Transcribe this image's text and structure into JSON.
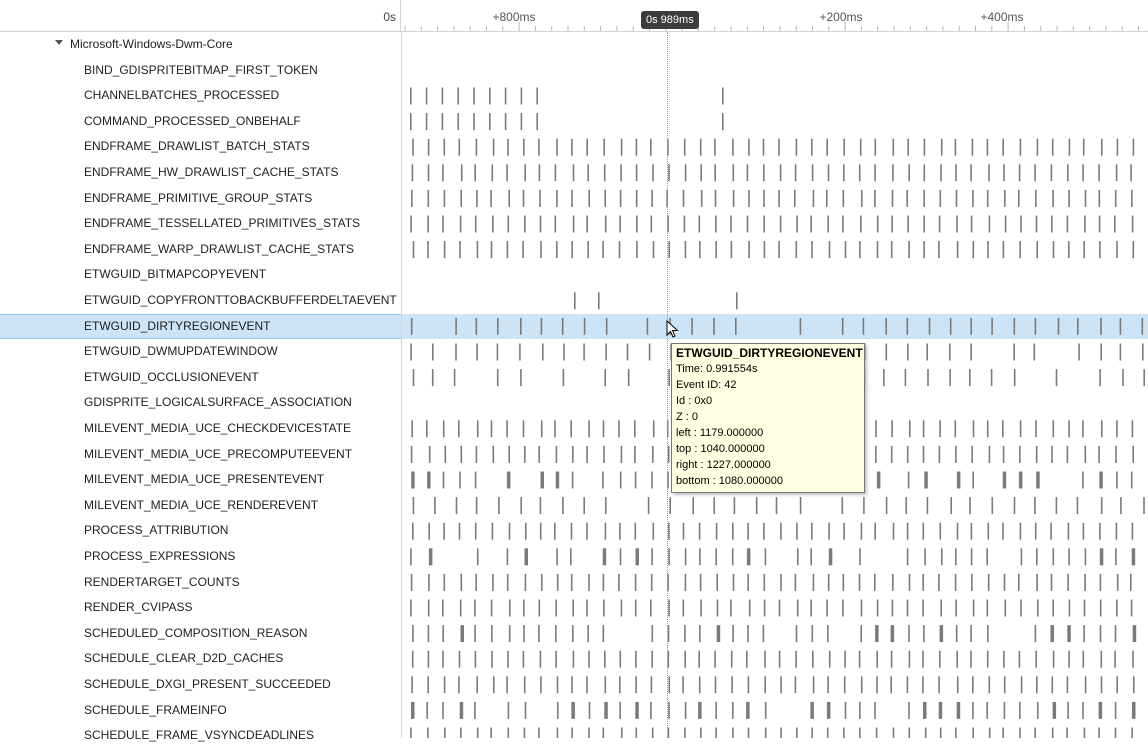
{
  "ruler": {
    "origin_label": "0s",
    "cursor_label": "0s 989ms",
    "tick_labels": [
      "+800ms",
      "+200ms",
      "+400ms"
    ]
  },
  "provider": {
    "name": "Microsoft-Windows-Dwm-Core",
    "expanded": true
  },
  "events": [
    "BIND_GDISPRITEBITMAP_FIRST_TOKEN",
    "CHANNELBATCHES_PROCESSED",
    "COMMAND_PROCESSED_ONBEHALF",
    "ENDFRAME_DRAWLIST_BATCH_STATS",
    "ENDFRAME_HW_DRAWLIST_CACHE_STATS",
    "ENDFRAME_PRIMITIVE_GROUP_STATS",
    "ENDFRAME_TESSELLATED_PRIMITIVES_STATS",
    "ENDFRAME_WARP_DRAWLIST_CACHE_STATS",
    "ETWGUID_BITMAPCOPYEVENT",
    "ETWGUID_COPYFRONTTOBACKBUFFERDELTAEVENT",
    "ETWGUID_DIRTYREGIONEVENT",
    "ETWGUID_DWMUPDATEWINDOW",
    "ETWGUID_OCCLUSIONEVENT",
    "GDISPRITE_LOGICALSURFACE_ASSOCIATION",
    "MILEVENT_MEDIA_UCE_CHECKDEVICESTATE",
    "MILEVENT_MEDIA_UCE_PRECOMPUTEEVENT",
    "MILEVENT_MEDIA_UCE_PRESENTEVENT",
    "MILEVENT_MEDIA_UCE_RENDEREVENT",
    "PROCESS_ATTRIBUTION",
    "PROCESS_EXPRESSIONS",
    "RENDERTARGET_COUNTS",
    "RENDER_CVIPASS",
    "SCHEDULED_COMPOSITION_REASON",
    "SCHEDULE_CLEAR_D2D_CACHES",
    "SCHEDULE_DXGI_PRESENT_SUCCEEDED",
    "SCHEDULE_FRAMEINFO",
    "SCHEDULE_FRAME_VSYNCDEADLINES"
  ],
  "selected_event": "ETWGUID_DIRTYREGIONEVENT",
  "tooltip": {
    "title": "ETWGUID_DIRTYREGIONEVENT",
    "lines": [
      "Time: 0.991554s",
      "Event ID: 42",
      "Id : 0x0",
      "Z : 0",
      "left : 1179.000000",
      "top : 1040.000000",
      "right : 1227.000000",
      "bottom : 1080.000000"
    ]
  },
  "colors": {
    "selection": "#cce4f7",
    "event_mark": "#7a7a7a",
    "tooltip_bg": "#ffffe1"
  }
}
